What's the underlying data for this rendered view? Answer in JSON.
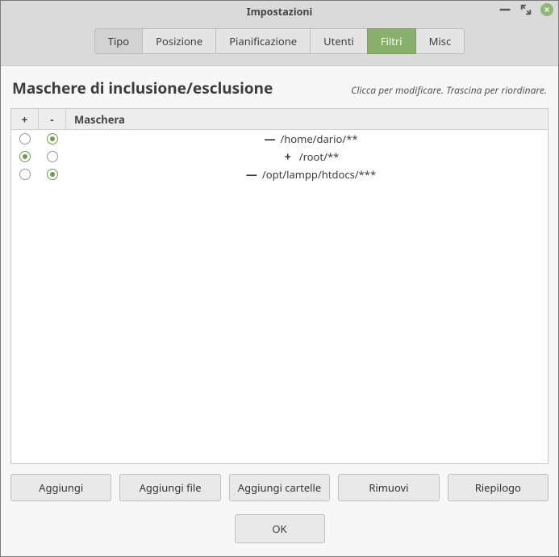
{
  "window": {
    "title": "Impostazioni"
  },
  "tabs": [
    {
      "label": "Tipo",
      "active": false
    },
    {
      "label": "Posizione",
      "active": false
    },
    {
      "label": "Pianificazione",
      "active": false
    },
    {
      "label": "Utenti",
      "active": false
    },
    {
      "label": "Filtri",
      "active": true
    },
    {
      "label": "Misc",
      "active": false
    }
  ],
  "heading": "Maschere di inclusione/esclusione",
  "hint": "Clicca per modificare. Trascina per riordinare.",
  "columns": {
    "plus": "+",
    "minus": "-",
    "mask": "Maschera"
  },
  "rows": [
    {
      "include": false,
      "exclude": true,
      "sign": "—",
      "pattern": "/home/dario/**"
    },
    {
      "include": true,
      "exclude": false,
      "sign": "+",
      "pattern": "/root/**"
    },
    {
      "include": false,
      "exclude": true,
      "sign": "—",
      "pattern": "/opt/lampp/htdocs/***"
    }
  ],
  "buttons": {
    "add": "Aggiungi",
    "add_file": "Aggiungi file",
    "add_folders": "Aggiungi cartelle",
    "remove": "Rimuovi",
    "summary": "Riepilogo",
    "ok": "OK"
  }
}
